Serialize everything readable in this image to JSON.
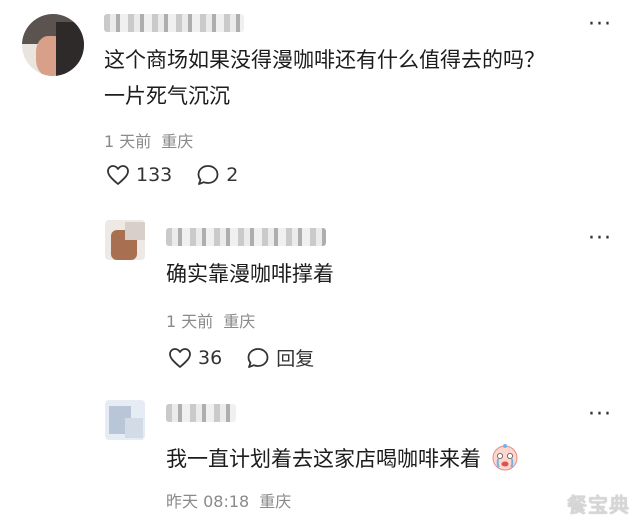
{
  "comments": [
    {
      "text_lines": [
        "这个商场如果没得漫咖啡还有什么值得去的吗？",
        "一片死气沉沉"
      ],
      "time": "1 天前",
      "location": "重庆",
      "likes": "133",
      "replies": "2"
    },
    {
      "text_lines": [
        "确实靠漫咖啡撑着"
      ],
      "time": "1 天前",
      "location": "重庆",
      "likes": "36",
      "reply_label": "回复"
    },
    {
      "text_lines": [
        "我一直计划着去这家店喝咖啡来着"
      ],
      "time": "昨天 08:18",
      "location": "重庆"
    }
  ],
  "more_label": "···",
  "watermark": "餐宝典",
  "icons": {
    "like": "heart-icon",
    "comment": "comment-bubble-icon",
    "more": "more-dots-icon",
    "emoji": "crying-face-icon"
  }
}
